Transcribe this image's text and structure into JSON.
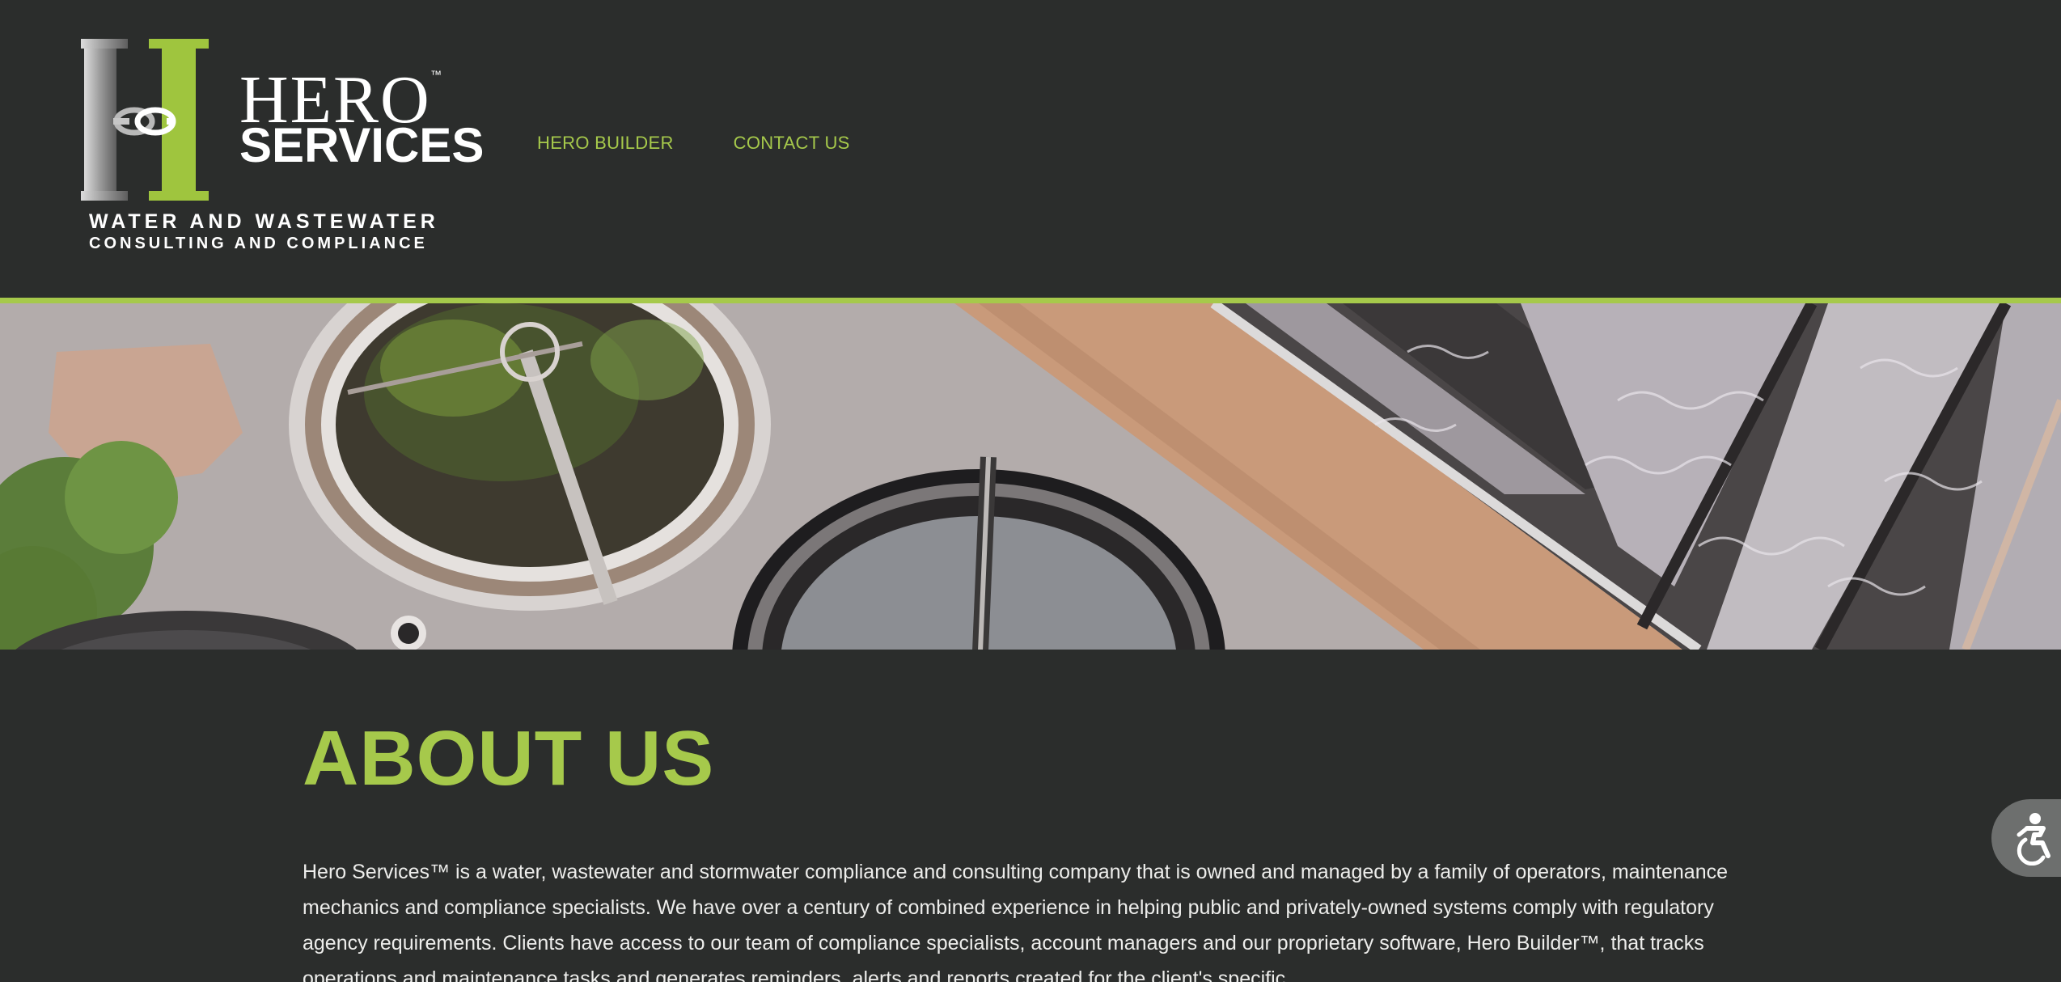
{
  "header": {
    "logo": {
      "word_hero": "HERO",
      "trademark": "™",
      "word_services": "SERVICES",
      "tagline_line1": "WATER AND WASTEWATER",
      "tagline_line2": "CONSULTING AND COMPLIANCE"
    },
    "nav": [
      {
        "label": "HERO BUILDER"
      },
      {
        "label": "CONTACT US"
      }
    ]
  },
  "hero_image": {
    "description_icon": "wastewater-treatment-aerial-photo"
  },
  "about": {
    "title": "ABOUT US",
    "body": "Hero Services™ is a water, wastewater and stormwater compliance and consulting company that is owned and managed by a family of operators, maintenance mechanics and compliance specialists. We have over a century of combined experience in helping public and privately-owned systems comply with regulatory agency requirements.  Clients have access to our team of compliance specialists, account managers and our proprietary software, Hero Builder™, that tracks operations and maintenance tasks and generates reminders, alerts and reports created for the client's specific"
  },
  "accessibility": {
    "icon": "accessibility-icon"
  },
  "colors": {
    "background": "#2b2d2c",
    "accent_green": "#a6c94b",
    "text": "#ededeb"
  }
}
